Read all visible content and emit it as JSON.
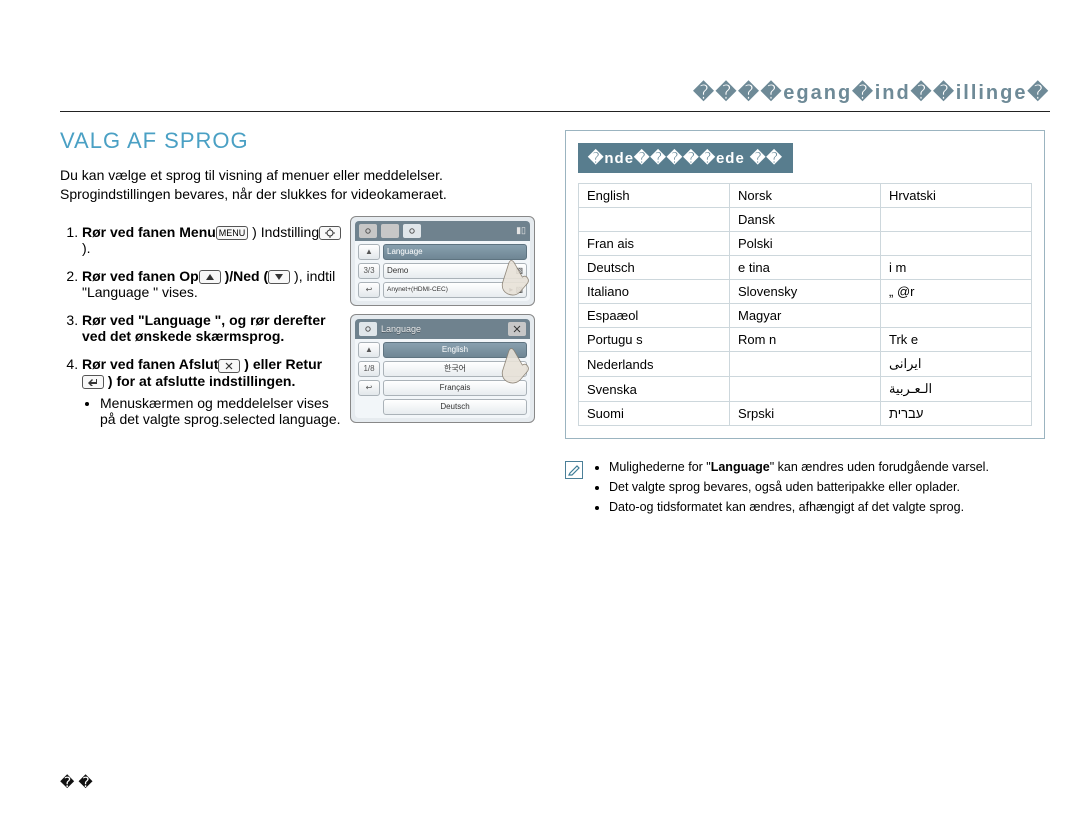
{
  "header": {
    "title": "����egang�ind��illinge�"
  },
  "section_title": "VALG AF SPROG",
  "intro": "Du kan vælge et sprog til visning af menuer eller meddelelser. Sprogindstillingen bevares, når der slukkes for videokameraet.",
  "steps": [
    {
      "prefix": "Rør ved fanen Menu",
      "icon_after_prefix": "MENU",
      "mid": " ) Indstilling",
      "icon_after_mid": "gear",
      "suffix": " )."
    },
    {
      "prefix": "Rør ved fanen Op",
      "icon_after_prefix": "up",
      "mid": " )/Ned (",
      "icon_after_mid": "down",
      "suffix": " ), indtil \"Language \" vises.",
      "bold_word": "Language"
    },
    {
      "prefix": "Rør ved \"",
      "bold_word": "Language",
      "mid": " \", og rør derefter ved det ønskede skærmsprog.",
      "icon_after_prefix": "",
      "suffix": ""
    },
    {
      "prefix": "Rør ved fanen Afslut",
      "icon_after_prefix": "close",
      "mid": " ) eller Retur ",
      "icon_after_mid": "return",
      "suffix": " ) for at afslutte indstillingen."
    }
  ],
  "step4_bullet": "Menuskærmen og meddelelser vises på det valgte sprog.selected language.",
  "device1": {
    "rows": [
      {
        "label": "Language",
        "selected": true
      },
      {
        "label": "Demo",
        "right": "▧"
      },
      {
        "label": "Anynet+(HDMI-CEC)",
        "right": "▸ ▧"
      }
    ],
    "side_labels": [
      "▲",
      "3/3",
      "↩"
    ]
  },
  "device2": {
    "title": "Language",
    "rows": [
      {
        "label": "English",
        "selected": true
      },
      {
        "label": "한국어"
      },
      {
        "label": "Français"
      },
      {
        "label": "Deutsch"
      }
    ],
    "side_labels": [
      "▲",
      "1/8",
      "↩"
    ]
  },
  "lang_header": "�nde�����ede ��",
  "languages": [
    [
      "English",
      "Norsk",
      "Hrvatski"
    ],
    [
      "",
      "Dansk",
      ""
    ],
    [
      "Fran ais",
      "Polski",
      ""
    ],
    [
      "Deutsch",
      "e tina",
      "i m"
    ],
    [
      "Italiano",
      "Slovensky",
      "„ @r"
    ],
    [
      "Espaæol",
      "Magyar",
      ""
    ],
    [
      "Portugu s",
      "Rom n",
      "Trk e"
    ],
    [
      "Nederlands",
      "",
      "ایرانی"
    ],
    [
      "Svenska",
      "",
      "الـعـربية"
    ],
    [
      "Suomi",
      "Srpski",
      "עברית"
    ]
  ],
  "notes": [
    {
      "pre": "Mulighederne for \"",
      "bold": "Language",
      "post": "\" kan ændres uden forudgående varsel."
    },
    {
      "text": "Det valgte sprog bevares, også uden batteripakke eller oplader."
    },
    {
      "text": "Dato-og tidsformatet kan ændres, afhængigt af det valgte sprog."
    }
  ],
  "page_number": "��"
}
